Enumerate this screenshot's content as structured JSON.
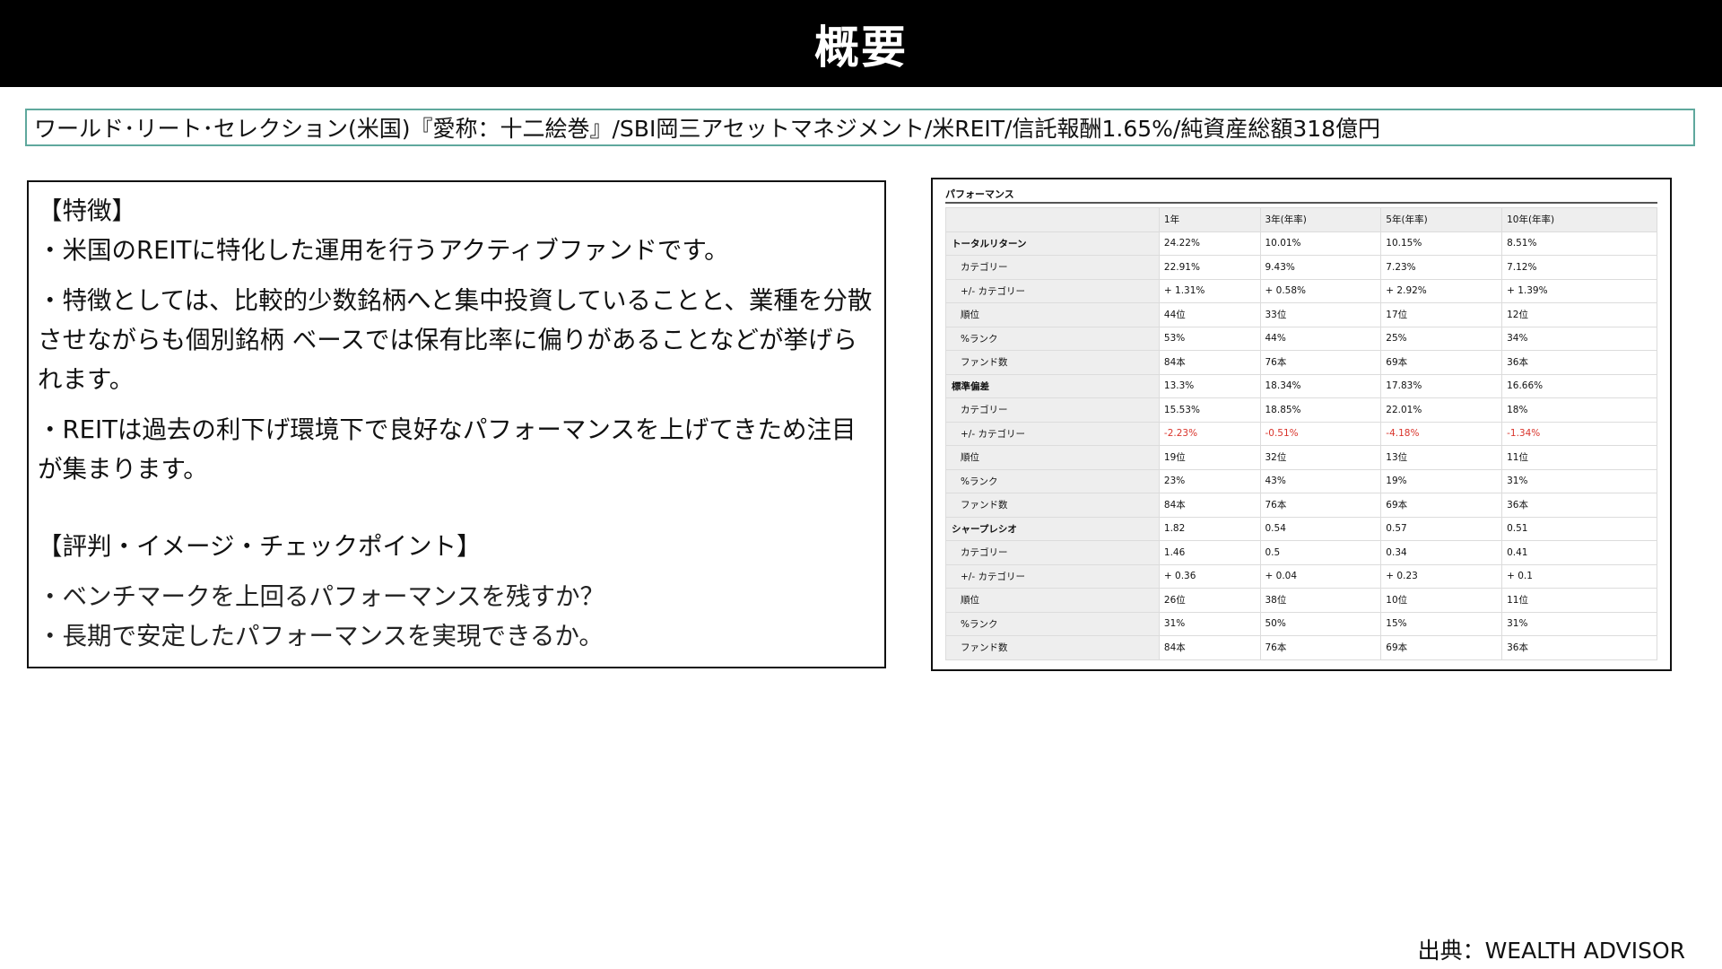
{
  "slide": {
    "title": "概要",
    "fund_line": "ワールド･リート･セレクション(米国)『愛称：十二絵巻』/SBI岡三アセットマネジメント/米REIT/信託報酬1.65%/純資産総額318億円",
    "source": "出典：WEALTH ADVISOR"
  },
  "features": {
    "heading": "【特徴】",
    "items": [
      "・米国のREITに特化した運用を行うアクティブファンドです。",
      "・特徴としては、比較的少数銘柄へと集中投資していることと、業種を分散させながらも個別銘柄 ベースでは保有比率に偏りがあることなどが挙げられます。",
      "・REITは過去の利下げ環境下で良好なパフォーマンスを上げてきため注目が集まります。"
    ]
  },
  "reputation": {
    "heading": "【評判・イメージ・チェックポイント】",
    "items": [
      "・ベンチマークを上回るパフォーマンスを残すか？",
      "・長期で安定したパフォーマンスを実現できるか。"
    ]
  },
  "performance": {
    "title": "パフォーマンス",
    "columns": [
      "",
      "1年",
      "3年(年率)",
      "5年(年率)",
      "10年(年率)"
    ],
    "rows": [
      {
        "label": "トータルリターン",
        "values": [
          "24.22%",
          "10.01%",
          "10.15%",
          "8.51%"
        ]
      },
      {
        "label": "カテゴリー",
        "values": [
          "22.91%",
          "9.43%",
          "7.23%",
          "7.12%"
        ]
      },
      {
        "label": "+/- カテゴリー",
        "values": [
          "+ 1.31%",
          "+ 0.58%",
          "+ 2.92%",
          "+ 1.39%"
        ]
      },
      {
        "label": "順位",
        "values": [
          "44位",
          "33位",
          "17位",
          "12位"
        ]
      },
      {
        "label": "%ランク",
        "values": [
          "53%",
          "44%",
          "25%",
          "34%"
        ]
      },
      {
        "label": "ファンド数",
        "values": [
          "84本",
          "76本",
          "69本",
          "36本"
        ]
      },
      {
        "label": "標準偏差",
        "values": [
          "13.3%",
          "18.34%",
          "17.83%",
          "16.66%"
        ]
      },
      {
        "label": "カテゴリー",
        "values": [
          "15.53%",
          "18.85%",
          "22.01%",
          "18%"
        ]
      },
      {
        "label": "+/- カテゴリー",
        "values": [
          "-2.23%",
          "-0.51%",
          "-4.18%",
          "-1.34%"
        ]
      },
      {
        "label": "順位",
        "values": [
          "19位",
          "32位",
          "13位",
          "11位"
        ]
      },
      {
        "label": "%ランク",
        "values": [
          "23%",
          "43%",
          "19%",
          "31%"
        ]
      },
      {
        "label": "ファンド数",
        "values": [
          "84本",
          "76本",
          "69本",
          "36本"
        ]
      },
      {
        "label": "シャープレシオ",
        "values": [
          "1.82",
          "0.54",
          "0.57",
          "0.51"
        ]
      },
      {
        "label": "カテゴリー",
        "values": [
          "1.46",
          "0.5",
          "0.34",
          "0.41"
        ]
      },
      {
        "label": "+/- カテゴリー",
        "values": [
          "+ 0.36",
          "+ 0.04",
          "+ 0.23",
          "+ 0.1"
        ]
      },
      {
        "label": "順位",
        "values": [
          "26位",
          "38位",
          "10位",
          "11位"
        ]
      },
      {
        "label": "%ランク",
        "values": [
          "31%",
          "50%",
          "15%",
          "31%"
        ]
      },
      {
        "label": "ファンド数",
        "values": [
          "84本",
          "76本",
          "69本",
          "36本"
        ]
      }
    ]
  },
  "colors": {
    "title_bg": "#000000",
    "fund_line_border": "#5fa89d",
    "negative": "#d9342b"
  }
}
